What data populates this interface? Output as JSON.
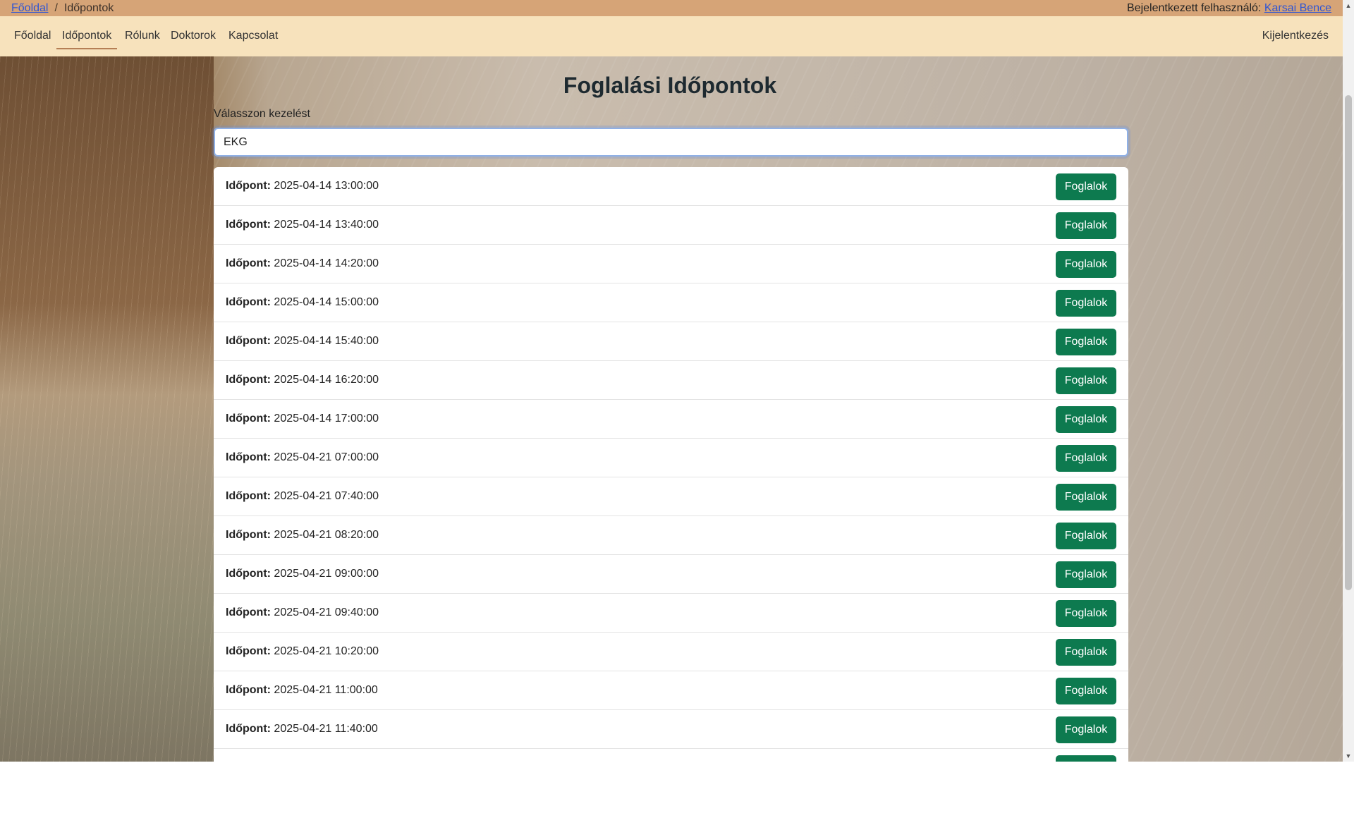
{
  "breadcrumb": {
    "home": "Főoldal",
    "separator": "/",
    "current": "Időpontok"
  },
  "user": {
    "prefix": "Bejelentkezett felhasználó:",
    "name": "Karsai Bence"
  },
  "nav": {
    "items": [
      "Főoldal",
      "Időpontok",
      "Rólunk",
      "Doktorok",
      "Kapcsolat"
    ],
    "active": "Időpontok",
    "logout": "Kijelentkezés"
  },
  "page": {
    "title": "Foglalási Időpontok",
    "select_label": "Válasszon kezelést",
    "select_value": "EKG"
  },
  "slots": {
    "label": "Időpont:",
    "button_label": "Foglalok",
    "button_color": "#0d7a4f",
    "items": [
      "2025-04-14 13:00:00",
      "2025-04-14 13:40:00",
      "2025-04-14 14:20:00",
      "2025-04-14 15:00:00",
      "2025-04-14 15:40:00",
      "2025-04-14 16:20:00",
      "2025-04-14 17:00:00",
      "2025-04-21 07:00:00",
      "2025-04-21 07:40:00",
      "2025-04-21 08:20:00",
      "2025-04-21 09:00:00",
      "2025-04-21 09:40:00",
      "2025-04-21 10:20:00",
      "2025-04-21 11:00:00",
      "2025-04-21 11:40:00"
    ]
  }
}
